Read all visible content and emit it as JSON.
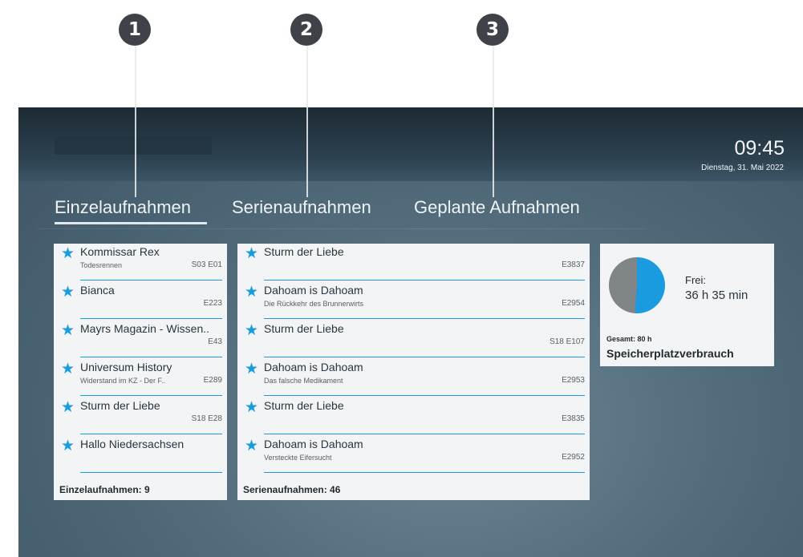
{
  "callouts": [
    "1",
    "2",
    "3"
  ],
  "header": {
    "time": "09:45",
    "date": "Dienstag, 31. Mai 2022"
  },
  "tabs": [
    {
      "label": "Einzelaufnahmen",
      "active": true
    },
    {
      "label": "Serienaufnahmen",
      "active": false
    },
    {
      "label": "Geplante Aufnahmen",
      "active": false
    }
  ],
  "single": {
    "items": [
      {
        "title": "Kommissar Rex",
        "subtitle": "Todesrennen",
        "episode": "S03 E01"
      },
      {
        "title": "Bianca",
        "subtitle": "",
        "episode": "E223"
      },
      {
        "title": "Mayrs Magazin - Wissen..",
        "subtitle": "",
        "episode": "E43"
      },
      {
        "title": "Universum History",
        "subtitle": "Widerstand im KZ - Der F..",
        "episode": "E289"
      },
      {
        "title": "Sturm der Liebe",
        "subtitle": "",
        "episode": "S18 E28"
      },
      {
        "title": "Hallo Niedersachsen",
        "subtitle": "",
        "episode": ""
      }
    ],
    "footer": "Einzelaufnahmen: 9"
  },
  "series": {
    "items": [
      {
        "title": "Sturm der Liebe",
        "subtitle": "",
        "episode": "E3837"
      },
      {
        "title": "Dahoam is Dahoam",
        "subtitle": "Die Rückkehr des Brunnerwirts",
        "episode": "E2954"
      },
      {
        "title": "Sturm der Liebe",
        "subtitle": "",
        "episode": "S18 E107"
      },
      {
        "title": "Dahoam is Dahoam",
        "subtitle": "Das falsche Medikament",
        "episode": "E2953"
      },
      {
        "title": "Sturm der Liebe",
        "subtitle": "",
        "episode": "E3835"
      },
      {
        "title": "Dahoam is Dahoam",
        "subtitle": "Versteckte Eifersucht",
        "episode": "E2952"
      }
    ],
    "footer": "Serienaufnahmen: 46"
  },
  "storage": {
    "free_label": "Frei:",
    "free_value": "36 h 35 min",
    "total": "Gesamt: 80 h",
    "title": "Speicherplatzverbrauch",
    "free_fraction": 0.51,
    "colors": {
      "free": "#1a9be0",
      "used": "#808588"
    }
  },
  "colors": {
    "accent": "#1a9be0",
    "badge": "#3f4248",
    "panel": "#f3f4f5"
  }
}
